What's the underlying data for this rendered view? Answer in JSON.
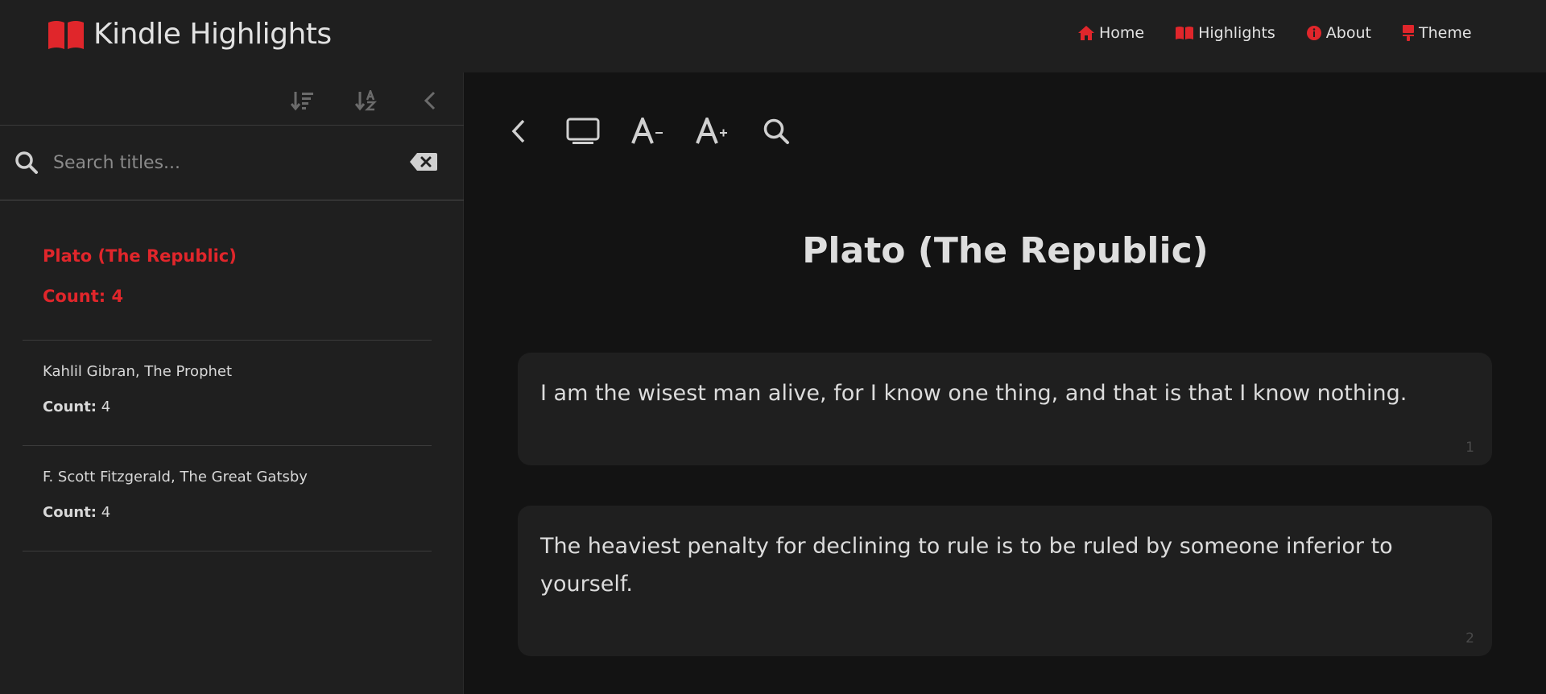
{
  "header": {
    "app_title": "Kindle Highlights",
    "nav": [
      {
        "label": "Home",
        "icon": "home-icon"
      },
      {
        "label": "Highlights",
        "icon": "book-open-icon"
      },
      {
        "label": "About",
        "icon": "info-icon"
      },
      {
        "label": "Theme",
        "icon": "paint-brush-icon"
      }
    ]
  },
  "sidebar": {
    "toolbar": [
      "sort-amount-down-icon",
      "sort-alpha-down-icon",
      "collapse-sidebar-icon"
    ],
    "search": {
      "placeholder": "Search titles...",
      "value": ""
    },
    "books": [
      {
        "title": "Plato (The Republic)",
        "count_label": "Count:",
        "count": "4",
        "active": true
      },
      {
        "title": "Kahlil Gibran, The Prophet",
        "count_label": "Count:",
        "count": "4",
        "active": false
      },
      {
        "title": "F. Scott Fitzgerald, The Great Gatsby",
        "count_label": "Count:",
        "count": "4",
        "active": false
      }
    ]
  },
  "main": {
    "toolbar": [
      "back-icon",
      "fullscreen-icon",
      "font-decrease-icon",
      "font-increase-icon",
      "search-icon"
    ],
    "book_title": "Plato (The Republic)",
    "highlights": [
      {
        "text": "I am the wisest man alive, for I know one thing, and that is that I know nothing.",
        "number": "1"
      },
      {
        "text": "The heaviest penalty for declining to rule is to be ruled by someone inferior to yourself.",
        "number": "2"
      }
    ]
  },
  "colors": {
    "accent": "#e0262b",
    "background": "#131313",
    "panel": "#1f1f1f",
    "text": "#dcdcdc"
  }
}
